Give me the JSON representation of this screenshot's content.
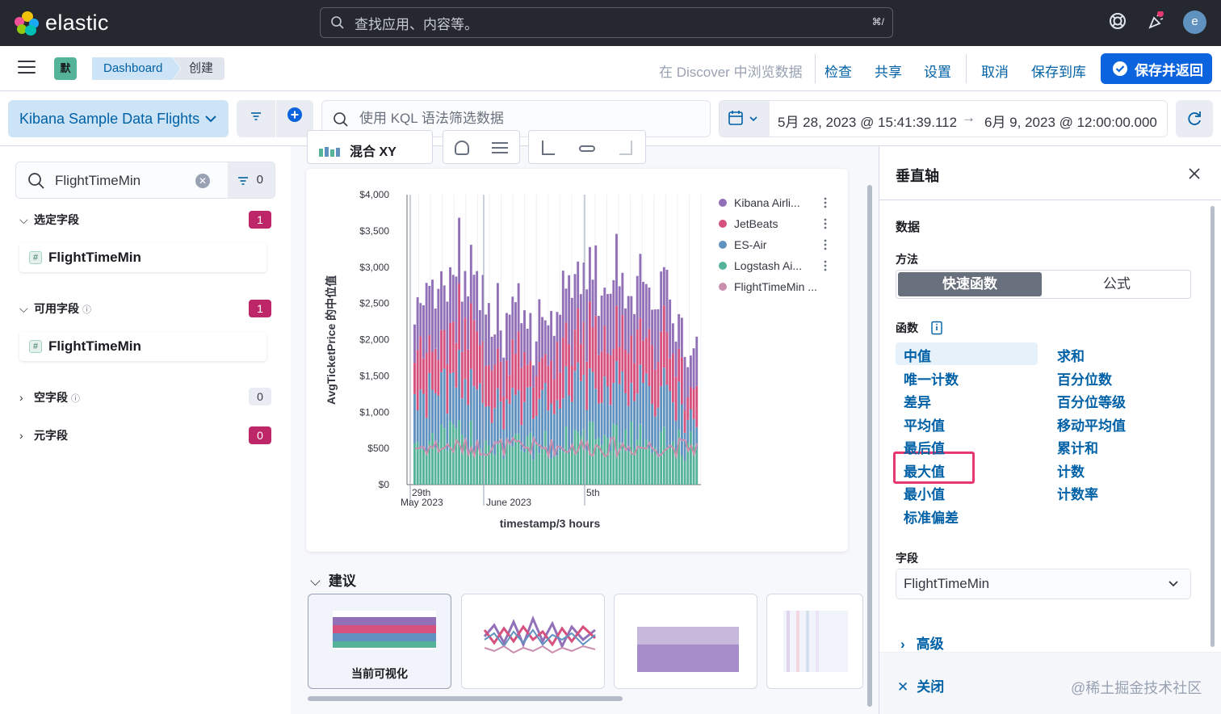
{
  "brand": {
    "name": "elastic"
  },
  "header": {
    "search_placeholder": "查找应用、内容等。",
    "search_shortcut": "⌘/",
    "avatar_initial": "e"
  },
  "nav": {
    "space_badge": "默",
    "breadcrumbs": [
      "Dashboard",
      "创建"
    ],
    "links": {
      "discover": "在 Discover 中浏览数据",
      "inspect": "检查",
      "share": "共享",
      "settings": "设置",
      "cancel": "取消",
      "save_library": "保存到库",
      "save_return": "保存并返回"
    }
  },
  "filterbar": {
    "data_view": "Kibana Sample Data Flights",
    "kql_placeholder": "使用 KQL 语法筛选数据",
    "date_start": "5月 28, 2023 @ 15:41:39.112",
    "date_arrow": "→",
    "date_end": "6月 9, 2023 @ 12:00:00.000"
  },
  "fields_panel": {
    "search_value": "FlightTimeMin",
    "filter_count": "0",
    "sections": [
      {
        "label": "选定字段",
        "count": "1",
        "field": "FlightTimeMin"
      },
      {
        "label": "可用字段",
        "count": "1",
        "field": "FlightTimeMin"
      },
      {
        "label": "空字段",
        "count": "0"
      },
      {
        "label": "元字段",
        "count": "0"
      }
    ],
    "field_type_glyph": "#",
    "info_glyph": "ⓘ"
  },
  "workspace": {
    "vis_type": "混合 XY",
    "suggestions_title": "建议",
    "current_suggestion_label": "当前可视化"
  },
  "chart_data": {
    "type": "bar",
    "stacked": true,
    "xlabel": "timestamp/3 hours",
    "ylabel": "AvgTicketPrice 的中位值",
    "ylim": [
      0,
      4000
    ],
    "y_ticks": [
      "$0",
      "$500",
      "$1,000",
      "$1,500",
      "$2,000",
      "$2,500",
      "$3,000",
      "$3,500",
      "$4,000"
    ],
    "x_ticks": [
      {
        "label": "29th",
        "sub": "May 2023"
      },
      {
        "label": "",
        "sub": "June 2023"
      },
      {
        "label": "5th",
        "sub": ""
      }
    ],
    "series": [
      {
        "name": "Kibana Airli...",
        "color": "#9170b8",
        "typical": 720
      },
      {
        "name": "JetBeats",
        "color": "#d6517d",
        "typical": 680
      },
      {
        "name": "ES-Air",
        "color": "#6092c0",
        "typical": 700
      },
      {
        "name": "Logstash Ai...",
        "color": "#54b399",
        "typical": 620
      },
      {
        "name": "FlightTimeMin ...",
        "color": "#ca8eae",
        "typical": 520,
        "line": true
      }
    ],
    "grid": true,
    "legend": "right"
  },
  "flyout": {
    "title": "垂直轴",
    "data_label": "数据",
    "method_label": "方法",
    "method_options": [
      "快速函数",
      "公式"
    ],
    "functions_label": "函数",
    "functions_left": [
      "中值",
      "唯一计数",
      "差异",
      "平均值",
      "最后值",
      "最大值",
      "最小值",
      "标准偏差"
    ],
    "functions_right": [
      "求和",
      "百分位数",
      "百分位等级",
      "移动平均值",
      "累计和",
      "计数",
      "计数率"
    ],
    "selected_function": "中值",
    "highlighted_function": "最大值",
    "field_label": "字段",
    "field_value": "FlightTimeMin",
    "advanced_label": "高级",
    "close_label": "关闭"
  },
  "watermark": "@稀土掘金技术社区"
}
